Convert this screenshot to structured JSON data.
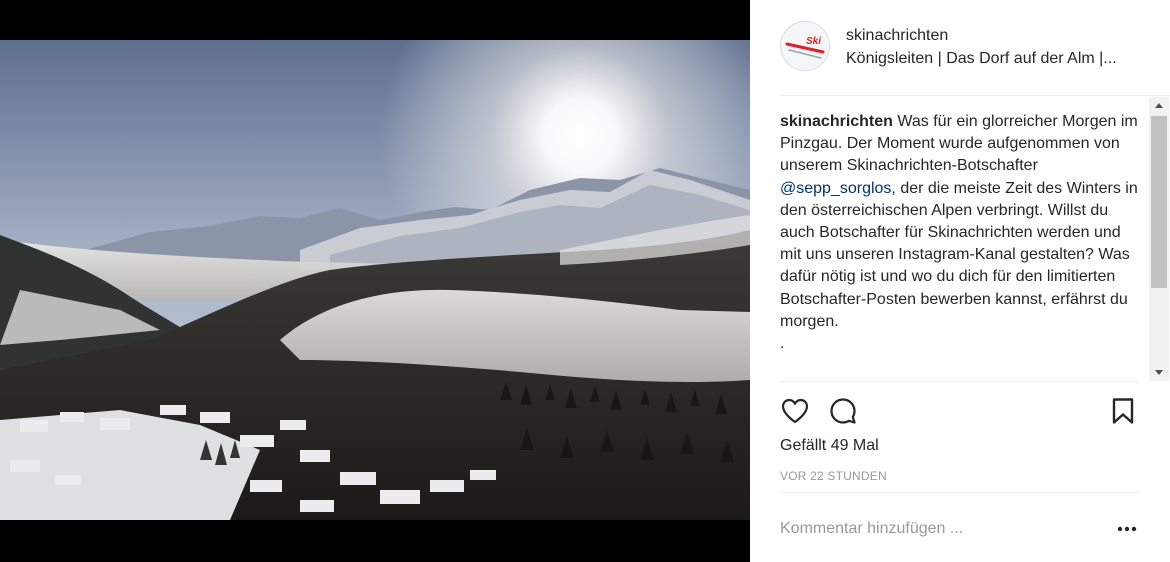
{
  "post": {
    "username": "skinachrichten",
    "location": "Königsleiten | Das Dorf auf der Alm |...",
    "avatar_text": "Ski",
    "caption": {
      "user": "skinachrichten",
      "text_before_mention": " Was für ein glorreicher Morgen im Pinzgau. Der Moment wurde aufgenommen von unserem Skinachrichten-Botschafter ",
      "mention": "@sepp_sorglos",
      "text_after_mention": ", der die meiste Zeit des Winters in den österreichischen Alpen verbringt. Willst du auch Botschafter für Skinachrichten werden und mit uns unseren Instagram-Kanal gestalten? Was dafür nötig ist und wo du dich für den limitierten Botschafter-Posten bewerben kannst, erfährst du morgen.",
      "trailing": "."
    },
    "likes_label": "Gefällt 49 Mal",
    "timestamp": "VOR 22 STUNDEN",
    "comment_placeholder": "Kommentar hinzufügen ..."
  },
  "icons": {
    "like": "heart-outline-icon",
    "comment": "comment-bubble-icon",
    "save": "bookmark-icon",
    "more": "ellipsis-icon"
  },
  "colors": {
    "mention": "#003569",
    "muted": "#999999",
    "avatar_accent": "#d8232a"
  }
}
